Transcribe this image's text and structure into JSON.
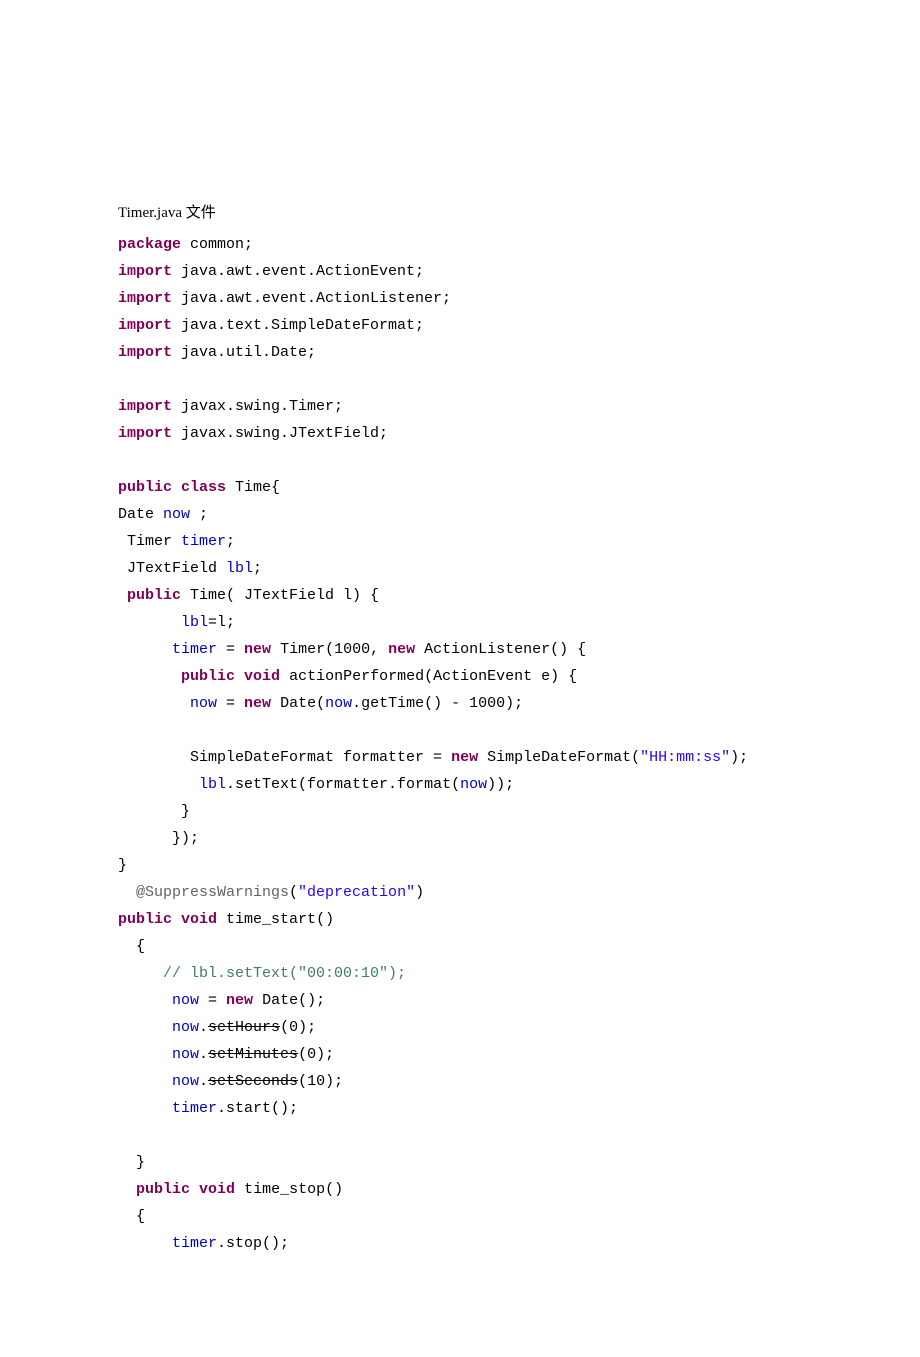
{
  "heading": "Timer.java 文件",
  "code": {
    "pkg_kw": "package",
    "pkg_name": " common;",
    "import_kw": "import",
    "imp1": " java.awt.event.ActionEvent;",
    "imp2": " java.awt.event.ActionListener;",
    "imp3": " java.text.SimpleDateFormat;",
    "imp4": " java.util.Date;",
    "imp5": " javax.swing.Timer;",
    "imp6": " javax.swing.JTextField;",
    "public_kw": "public",
    "class_kw": "class",
    "class_name": " Time{",
    "date_decl_a": "Date ",
    "date_decl_b": "now",
    "date_decl_c": " ;",
    "timer_decl_a": " Timer ",
    "timer_decl_b": "timer",
    "timer_decl_c": ";",
    "jtf_decl_a": " JTextField ",
    "jtf_decl_b": "lbl",
    "jtf_decl_c": ";",
    "ctor_sig_a": " Time( JTextField l) {",
    "lbl_assign_a": "       ",
    "lbl_assign_b": "lbl",
    "lbl_assign_c": "=l;",
    "timer_new_a": "      ",
    "timer_new_b": "timer",
    "timer_new_c": " = ",
    "new_kw": "new",
    "timer_new_d": " Timer(1000, ",
    "timer_new_e": " ActionListener() {",
    "void_kw": "void",
    "ap_sig": " actionPerformed(ActionEvent e) {",
    "now_assign_a": "        ",
    "now_assign_b": "now",
    "now_assign_c": " = ",
    "now_assign_d": " Date(",
    "now_assign_e": "now",
    "now_assign_f": ".getTime() - 1000);",
    "sdf_line_a": "        SimpleDateFormat formatter = ",
    "sdf_line_b": " SimpleDateFormat(",
    "sdf_str": "\"HH:mm:ss\"",
    "sdf_line_c": ");",
    "set_text_a": "         ",
    "set_text_b": "lbl",
    "set_text_c": ".setText(formatter.format(",
    "set_text_d": "now",
    "set_text_e": "));",
    "close1": "       }",
    "close2": "      });",
    "close3": "}",
    "ann_a": "  @SuppressWarnings",
    "ann_b": "(",
    "ann_str": "\"deprecation\"",
    "ann_c": ")",
    "ts_sig": " time_start()",
    "open_brace": "  {",
    "comment": "     // lbl.setText(\"00:00:10\");",
    "ts_now_a": "      ",
    "ts_now_b": "now",
    "ts_now_c": " = ",
    "ts_now_d": " Date();",
    "sh_a": "      ",
    "sh_b": "now",
    "sh_c": ".",
    "sh_d": "setHours",
    "sh_e": "(0);",
    "sm_a": "      ",
    "sm_b": "now",
    "sm_c": ".",
    "sm_d": "setMinutes",
    "sm_e": "(0);",
    "ss_a": "      ",
    "ss_b": "now",
    "ss_c": ".",
    "ss_d": "setSeconds",
    "ss_e": "(10);",
    "tstart_a": "      ",
    "tstart_b": "timer",
    "tstart_c": ".start();",
    "close4": "  }",
    "tstop_sig": " time_stop()",
    "open_brace2": "  {",
    "tstop_a": "      ",
    "tstop_b": "timer",
    "tstop_c": ".stop();"
  }
}
